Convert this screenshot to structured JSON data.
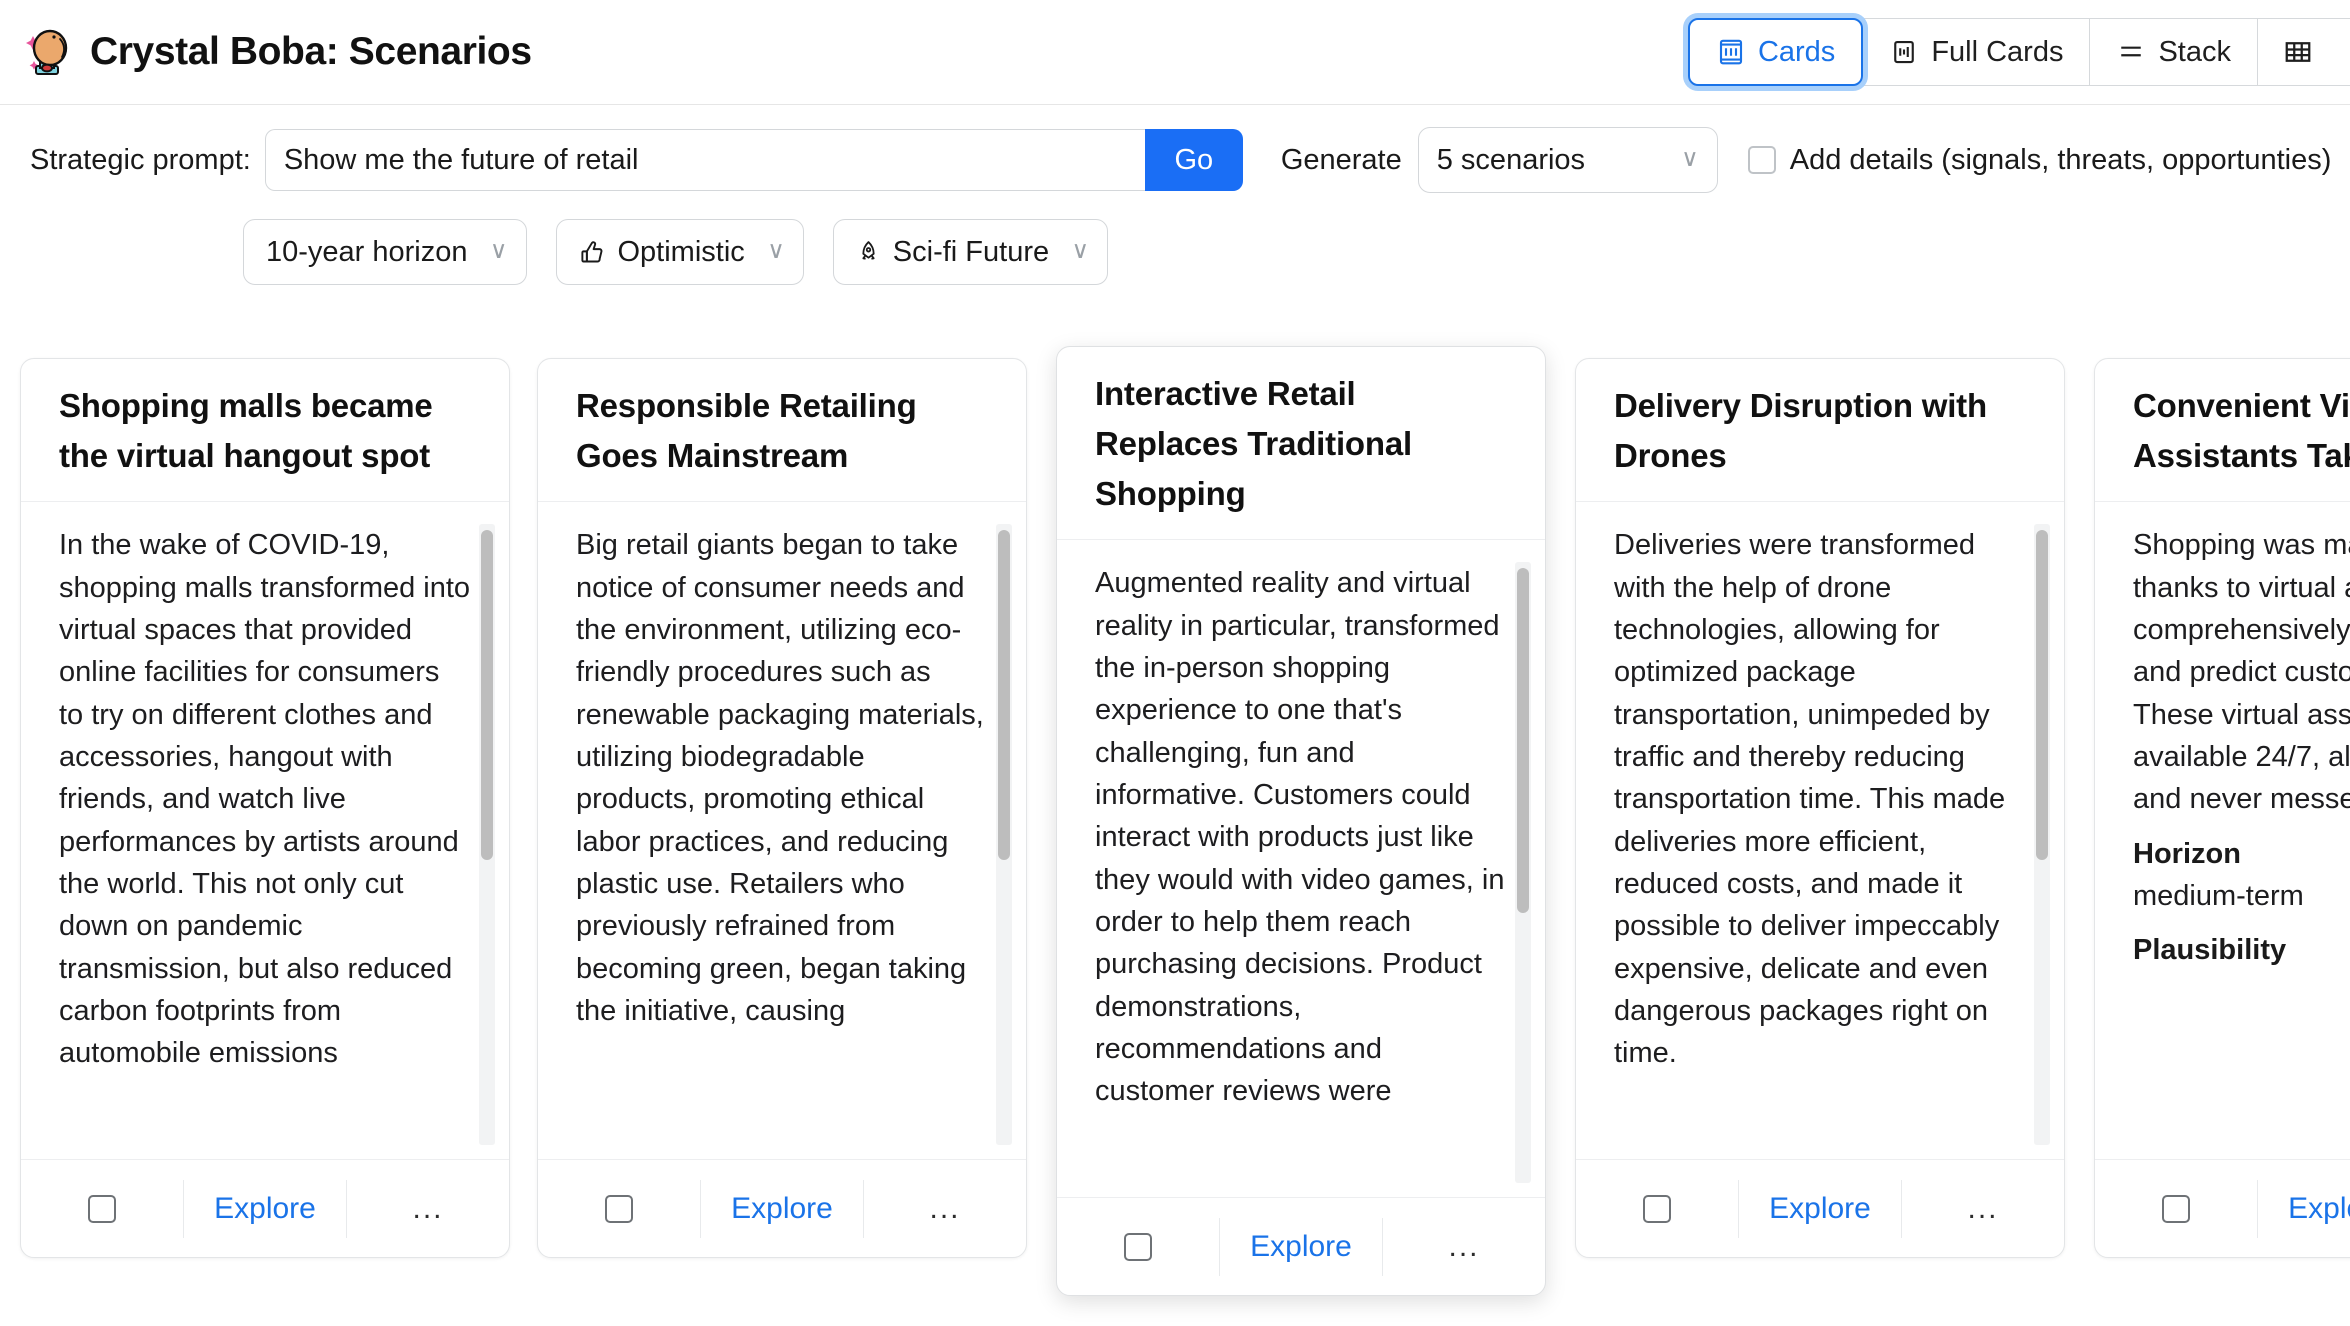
{
  "header": {
    "title": "Crystal Boba: Scenarios",
    "logo_icon": "crystal-ball-boba-logo",
    "views": [
      {
        "label": "Cards",
        "icon": "cards-icon",
        "active": true
      },
      {
        "label": "Full Cards",
        "icon": "full-cards-icon",
        "active": false
      },
      {
        "label": "Stack",
        "icon": "stack-lines-icon",
        "active": false
      },
      {
        "label": "",
        "icon": "grid-table-icon",
        "active": false
      }
    ]
  },
  "controls": {
    "prompt_label": "Strategic prompt:",
    "prompt_value": "Show me the future of retail",
    "prompt_placeholder": "Show me the future of retail",
    "go_label": "Go",
    "generate_label": "Generate",
    "scenario_count": "5 scenarios",
    "add_details_label": "Add details (signals, threats, opportunties)",
    "add_details_checked": false,
    "pills": [
      {
        "label": "10-year horizon",
        "icon": ""
      },
      {
        "label": "Optimistic",
        "icon": "thumbs-up-icon"
      },
      {
        "label": "Sci-fi Future",
        "icon": "rocket-icon"
      }
    ]
  },
  "cards": [
    {
      "title": "Shopping malls became the virtual hangout spot",
      "text": "In the wake of COVID-19, shopping malls transformed into virtual spaces that provided online facilities for consumers to try on different clothes and accessories, hangout with friends, and watch live performances by artists around the world. This not only cut down on pandemic transmission, but also reduced carbon footprints from automobile emissions",
      "explore_label": "Explore",
      "more_label": "...",
      "checked": false
    },
    {
      "title": "Responsible Retailing Goes Mainstream",
      "text": "Big retail giants began to take notice of consumer needs and the environment, utilizing eco-friendly procedures such as renewable packaging materials, utilizing biodegradable products, promoting ethical labor practices, and reducing plastic use. Retailers who previously refrained from becoming green, began taking the initiative, causing",
      "explore_label": "Explore",
      "more_label": "...",
      "checked": false
    },
    {
      "title": "Interactive Retail Replaces Traditional Shopping",
      "text": "Augmented reality and virtual reality in particular, transformed the in-person shopping experience to one that's challenging, fun and informative. Customers could interact with products just like they would with video games, in order to help them reach purchasing decisions. Product demonstrations, recommendations and customer reviews were",
      "explore_label": "Explore",
      "more_label": "...",
      "checked": false
    },
    {
      "title": "Delivery Disruption with Drones",
      "text": "Deliveries were transformed with the help of drone technologies, allowing for optimized package transportation, unimpeded by traffic and thereby reducing transportation time. This made deliveries more efficient, reduced costs, and made it possible to deliver impeccably expensive, delicate and even dangerous packages right on time.",
      "explore_label": "Explore",
      "more_label": "...",
      "checked": false
    },
    {
      "title": "Convenient Virtual Assistants Take Over",
      "text": "Shopping was made easier thanks to virtual assistants that comprehensively understand and predict customer needs. These virtual assistants were available 24/7, always patient, and never messed up an order.",
      "horizon_label": "Horizon",
      "horizon_value": "medium-term",
      "plausibility_label": "Plausibility",
      "explore_label": "Explore",
      "more_label": "...",
      "checked": false
    }
  ],
  "colors": {
    "accent": "#1a73e8",
    "go_button": "#1a6ef5",
    "border": "#e3e5e7"
  }
}
